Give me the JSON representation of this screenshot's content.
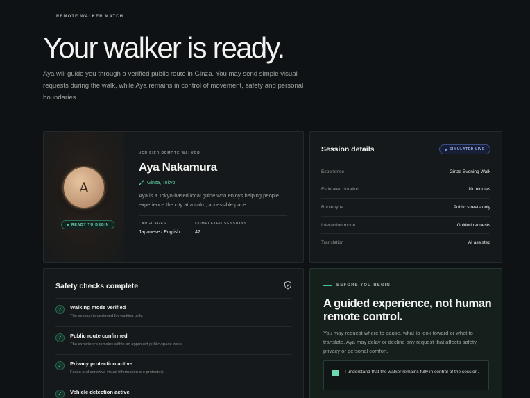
{
  "header": {
    "eyebrow": "REMOTE WALKER MATCH",
    "title": "Your walker is ready.",
    "subtitle": "Aya will guide you through a verified public route in Ginza. You may send simple visual requests during the walk, while Aya remains in control of movement, safety and personal boundaries."
  },
  "profile": {
    "avatar_initial": "A",
    "status_badge": "READY TO BEGIN",
    "verified_label": "VERIFIED REMOTE WALKER",
    "name": "Aya Nakamura",
    "location": "Ginza, Tokyo",
    "bio": "Aya is a Tokyo-based local guide who enjoys helping people experience the city at a calm, accessible pace.",
    "languages_label": "LANGUAGES",
    "languages_value": "Japanese / English",
    "sessions_label": "COMPLETED SESSIONS",
    "sessions_value": "42"
  },
  "session": {
    "title": "Session details",
    "badge": "SIMULATED LIVE",
    "rows": [
      {
        "key": "Experience",
        "value": "Ginza Evening Walk"
      },
      {
        "key": "Estimated duration",
        "value": "10 minutes"
      },
      {
        "key": "Route type",
        "value": "Public streets only"
      },
      {
        "key": "Interaction mode",
        "value": "Guided requests"
      },
      {
        "key": "Translation",
        "value": "AI assisted"
      }
    ]
  },
  "safety": {
    "title": "Safety checks complete",
    "icon": "shield-check-icon",
    "items": [
      {
        "title": "Walking mode verified",
        "desc": "The session is designed for walking only."
      },
      {
        "title": "Public route confirmed",
        "desc": "The experience remains within an approved public-space zone."
      },
      {
        "title": "Privacy protection active",
        "desc": "Faces and sensitive visual information are protected."
      },
      {
        "title": "Vehicle detection active",
        "desc": ""
      }
    ]
  },
  "notice": {
    "eyebrow": "BEFORE YOU BEGIN",
    "title": "A guided experience, not human remote control.",
    "body": "You may request where to pause, what to look toward or what to translate. Aya may delay or decline any request that affects safety, privacy or personal comfort.",
    "consent_text": "I understand that the walker remains fully in control of the session.",
    "consent_checked": true
  },
  "colors": {
    "background": "#0f1214",
    "accent": "#52d19f",
    "badge_blue": "#9fb3ee"
  }
}
